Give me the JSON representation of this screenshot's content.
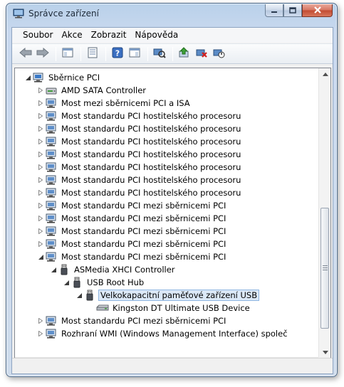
{
  "window": {
    "title": "Správce zařízení"
  },
  "menu": [
    "Soubor",
    "Akce",
    "Zobrazit",
    "Nápověda"
  ],
  "toolbar": {
    "buttons": [
      "back-icon",
      "forward-icon",
      "show-hide-tree-icon",
      "properties-icon",
      "help-icon",
      "action-pane-icon",
      "scan-hardware-icon",
      "update-driver-icon",
      "uninstall-icon",
      "disable-device-icon"
    ]
  },
  "tree": {
    "items": [
      {
        "label": "Sběrnice PCI",
        "icon": "computer-bus-icon",
        "expanded": true
      },
      {
        "label": "AMD SATA Controller",
        "icon": "storage-controller-icon",
        "expanded": false
      },
      {
        "label": "Most mezi sběrnicemi PCI a ISA",
        "icon": "device-icon",
        "expanded": false
      },
      {
        "label": "Most standardu PCI hostitelského procesoru",
        "icon": "device-icon",
        "expanded": false
      },
      {
        "label": "Most standardu PCI hostitelského procesoru",
        "icon": "device-icon",
        "expanded": false
      },
      {
        "label": "Most standardu PCI hostitelského procesoru",
        "icon": "device-icon",
        "expanded": false
      },
      {
        "label": "Most standardu PCI hostitelského procesoru",
        "icon": "device-icon",
        "expanded": false
      },
      {
        "label": "Most standardu PCI hostitelského procesoru",
        "icon": "device-icon",
        "expanded": false
      },
      {
        "label": "Most standardu PCI hostitelského procesoru",
        "icon": "device-icon",
        "expanded": false
      },
      {
        "label": "Most standardu PCI hostitelského procesoru",
        "icon": "device-icon",
        "expanded": false
      },
      {
        "label": "Most standardu PCI mezi sběrnicemi PCI",
        "icon": "device-icon",
        "expanded": false
      },
      {
        "label": "Most standardu PCI mezi sběrnicemi PCI",
        "icon": "device-icon",
        "expanded": false
      },
      {
        "label": "Most standardu PCI mezi sběrnicemi PCI",
        "icon": "device-icon",
        "expanded": false
      },
      {
        "label": "Most standardu PCI mezi sběrnicemi PCI",
        "icon": "device-icon",
        "expanded": false
      },
      {
        "label": "Most standardu PCI mezi sběrnicemi PCI",
        "icon": "device-icon",
        "expanded": true
      },
      {
        "label": "ASMedia XHCI Controller",
        "icon": "usb-icon",
        "expanded": true
      },
      {
        "label": "USB Root Hub",
        "icon": "usb-icon",
        "expanded": true
      },
      {
        "label": "Velkokapacitní paměťové zařízení USB",
        "icon": "usb-icon",
        "expanded": true,
        "selected": true
      },
      {
        "label": "Kingston DT Ultimate USB Device",
        "icon": "disk-drive-icon",
        "expanded": null
      },
      {
        "label": "Most standardu PCI mezi sběrnicemi PCI",
        "icon": "device-icon",
        "expanded": false
      },
      {
        "label": "Rozhraní WMI (Windows Management Interface) společ",
        "icon": "device-icon",
        "expanded": false
      }
    ]
  },
  "colors": {
    "selection": "#dbe8f7",
    "selection_border": "#8fb6e2"
  }
}
